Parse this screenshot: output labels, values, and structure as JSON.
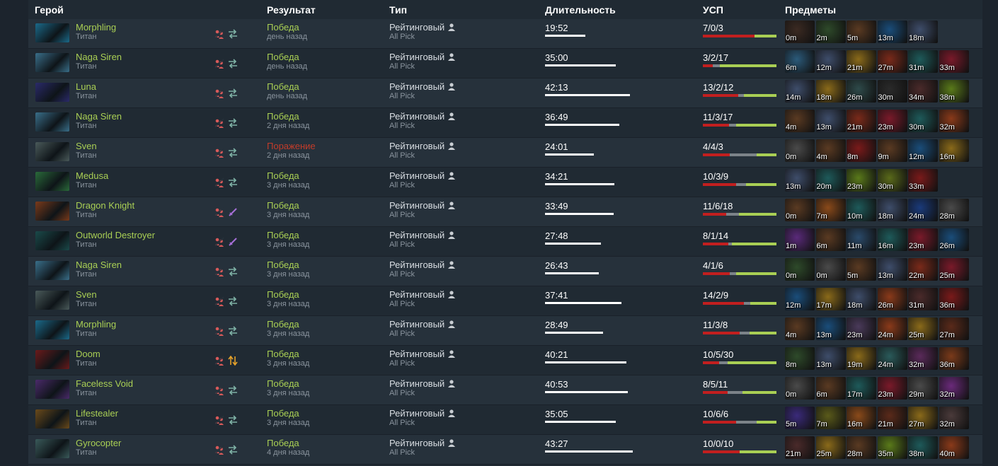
{
  "headers": {
    "hero": "Герой",
    "result": "Результат",
    "type": "Тип",
    "duration": "Длительность",
    "kda": "УСП",
    "items": "Предметы"
  },
  "colors": {
    "win": "#a9cf54",
    "loss": "#c23c2a",
    "kills": "#c21f1f",
    "deaths": "#7c8389",
    "assists": "#a9cf54"
  },
  "rows": [
    {
      "hero": "Morphling",
      "rank": "Титан",
      "icon2": "swap-icon",
      "result": "Победа",
      "win": true,
      "ago": "день назад",
      "type": "Рейтинговый",
      "mode": "All Pick",
      "duration": "19:52",
      "kda": "7/0/3",
      "items": [
        "0m",
        "2m",
        "5m",
        "13m",
        "18m"
      ],
      "itemColors": [
        "#3b2a22",
        "#2e4a2a",
        "#5a3a22",
        "#1a4d7a",
        "#3e4d6a"
      ]
    },
    {
      "hero": "Naga Siren",
      "rank": "Титан",
      "icon2": "swap-icon",
      "result": "Победа",
      "win": true,
      "ago": "день назад",
      "type": "Рейтинговый",
      "mode": "All Pick",
      "duration": "35:00",
      "kda": "3/2/17",
      "items": [
        "6m",
        "12m",
        "21m",
        "27m",
        "31m",
        "33m"
      ],
      "itemColors": [
        "#2b5a7a",
        "#3e4d6a",
        "#8a6a1a",
        "#7a2a1a",
        "#1e5a5a",
        "#7a1a2a"
      ]
    },
    {
      "hero": "Luna",
      "rank": "Титан",
      "icon2": "swap-icon",
      "result": "Победа",
      "win": true,
      "ago": "день назад",
      "type": "Рейтинговый",
      "mode": "All Pick",
      "duration": "42:13",
      "kda": "13/2/12",
      "items": [
        "14m",
        "18m",
        "26m",
        "30m",
        "34m",
        "38m"
      ],
      "itemColors": [
        "#3e4d6a",
        "#8a6a1a",
        "#2e4a4a",
        "#2a2a2a",
        "#4a2a2a",
        "#5a7a1a"
      ]
    },
    {
      "hero": "Naga Siren",
      "rank": "Титан",
      "icon2": "swap-icon",
      "result": "Победа",
      "win": true,
      "ago": "2 дня назад",
      "type": "Рейтинговый",
      "mode": "All Pick",
      "duration": "36:49",
      "kda": "11/3/17",
      "items": [
        "4m",
        "13m",
        "21m",
        "23m",
        "30m",
        "32m"
      ],
      "itemColors": [
        "#5a3a22",
        "#3e4d6a",
        "#7a2a1a",
        "#7a1a2a",
        "#1e5a5a",
        "#8a3a1a"
      ]
    },
    {
      "hero": "Sven",
      "rank": "Титан",
      "icon2": "swap-icon",
      "result": "Поражение",
      "win": false,
      "ago": "2 дня назад",
      "type": "Рейтинговый",
      "mode": "All Pick",
      "duration": "24:01",
      "kda": "4/4/3",
      "items": [
        "0m",
        "4m",
        "8m",
        "9m",
        "12m",
        "16m"
      ],
      "itemColors": [
        "#4a4a4a",
        "#5a3a22",
        "#7a1a1a",
        "#5a3a22",
        "#1a4d7a",
        "#8a6a1a"
      ]
    },
    {
      "hero": "Medusa",
      "rank": "Титан",
      "icon2": "swap-icon",
      "result": "Победа",
      "win": true,
      "ago": "3 дня назад",
      "type": "Рейтинговый",
      "mode": "All Pick",
      "duration": "34:21",
      "kda": "10/3/9",
      "items": [
        "13m",
        "20m",
        "23m",
        "30m",
        "33m"
      ],
      "itemColors": [
        "#3e4d6a",
        "#1e5a5a",
        "#5a7a1a",
        "#5a6a1a",
        "#7a1a1a"
      ]
    },
    {
      "hero": "Dragon Knight",
      "rank": "Титан",
      "icon2": "sword-icon",
      "result": "Победа",
      "win": true,
      "ago": "3 дня назад",
      "type": "Рейтинговый",
      "mode": "All Pick",
      "duration": "33:49",
      "kda": "11/6/18",
      "items": [
        "0m",
        "7m",
        "10m",
        "18m",
        "24m",
        "28m"
      ],
      "itemColors": [
        "#5a3a22",
        "#8a4a1a",
        "#1e5a5a",
        "#3e4d6a",
        "#1a3a7a",
        "#4a4a4a"
      ]
    },
    {
      "hero": "Outworld Destroyer",
      "rank": "Титан",
      "icon2": "sword-icon",
      "result": "Победа",
      "win": true,
      "ago": "3 дня назад",
      "type": "Рейтинговый",
      "mode": "All Pick",
      "duration": "27:48",
      "kda": "8/1/14",
      "items": [
        "1m",
        "6m",
        "11m",
        "16m",
        "23m",
        "26m"
      ],
      "itemColors": [
        "#5a2a7a",
        "#5a3a22",
        "#2a4a6a",
        "#1e5a5a",
        "#7a1a2a",
        "#1a4d7a"
      ]
    },
    {
      "hero": "Naga Siren",
      "rank": "Титан",
      "icon2": "swap-icon",
      "result": "Победа",
      "win": true,
      "ago": "3 дня назад",
      "type": "Рейтинговый",
      "mode": "All Pick",
      "duration": "26:43",
      "kda": "4/1/6",
      "items": [
        "0m",
        "0m",
        "5m",
        "13m",
        "22m",
        "25m"
      ],
      "itemColors": [
        "#2e4a2a",
        "#4a4a4a",
        "#5a3a22",
        "#3e4d6a",
        "#7a2a1a",
        "#7a1a2a"
      ]
    },
    {
      "hero": "Sven",
      "rank": "Титан",
      "icon2": "swap-icon",
      "result": "Победа",
      "win": true,
      "ago": "3 дня назад",
      "type": "Рейтинговый",
      "mode": "All Pick",
      "duration": "37:41",
      "kda": "14/2/9",
      "items": [
        "12m",
        "17m",
        "18m",
        "26m",
        "31m",
        "36m"
      ],
      "itemColors": [
        "#1a4d7a",
        "#8a6a1a",
        "#3e4d6a",
        "#8a3a1a",
        "#4a2a2a",
        "#7a1a1a"
      ]
    },
    {
      "hero": "Morphling",
      "rank": "Титан",
      "icon2": "swap-icon",
      "result": "Победа",
      "win": true,
      "ago": "3 дня назад",
      "type": "Рейтинговый",
      "mode": "All Pick",
      "duration": "28:49",
      "kda": "11/3/8",
      "items": [
        "4m",
        "13m",
        "23m",
        "24m",
        "25m",
        "27m"
      ],
      "itemColors": [
        "#5a3a22",
        "#1a4d7a",
        "#4a3a5a",
        "#8a3a1a",
        "#8a6a1a",
        "#5a2a1a"
      ]
    },
    {
      "hero": "Doom",
      "rank": "Титан",
      "icon2": "arrows-icon",
      "result": "Победа",
      "win": true,
      "ago": "3 дня назад",
      "type": "Рейтинговый",
      "mode": "All Pick",
      "duration": "40:21",
      "kda": "10/5/30",
      "items": [
        "8m",
        "13m",
        "19m",
        "24m",
        "32m",
        "36m"
      ],
      "itemColors": [
        "#2e4a2a",
        "#3e4d6a",
        "#8a6a1a",
        "#2a5a5a",
        "#5a2a5a",
        "#7a3a1a"
      ]
    },
    {
      "hero": "Faceless Void",
      "rank": "Титан",
      "icon2": "swap-icon",
      "result": "Победа",
      "win": true,
      "ago": "3 дня назад",
      "type": "Рейтинговый",
      "mode": "All Pick",
      "duration": "40:53",
      "kda": "8/5/11",
      "items": [
        "0m",
        "6m",
        "17m",
        "23m",
        "29m",
        "32m"
      ],
      "itemColors": [
        "#4a4a4a",
        "#5a3a22",
        "#1e5a5a",
        "#7a1a2a",
        "#4a4a4a",
        "#6a2a7a"
      ]
    },
    {
      "hero": "Lifestealer",
      "rank": "Титан",
      "icon2": "swap-icon",
      "result": "Победа",
      "win": true,
      "ago": "3 дня назад",
      "type": "Рейтинговый",
      "mode": "All Pick",
      "duration": "35:05",
      "kda": "10/6/6",
      "items": [
        "5m",
        "7m",
        "16m",
        "21m",
        "27m",
        "32m"
      ],
      "itemColors": [
        "#3a2a7a",
        "#5a5a1a",
        "#8a4a1a",
        "#5a2a1a",
        "#8a6a1a",
        "#4a3a3a"
      ]
    },
    {
      "hero": "Gyrocopter",
      "rank": "Титан",
      "icon2": "swap-icon",
      "result": "Победа",
      "win": true,
      "ago": "4 дня назад",
      "type": "Рейтинговый",
      "mode": "All Pick",
      "duration": "43:27",
      "kda": "10/0/10",
      "items": [
        "21m",
        "25m",
        "28m",
        "35m",
        "38m",
        "40m"
      ],
      "itemColors": [
        "#4a2a2a",
        "#8a6a1a",
        "#5a3a22",
        "#5a7a1a",
        "#1e5a5a",
        "#8a3a1a"
      ]
    }
  ]
}
